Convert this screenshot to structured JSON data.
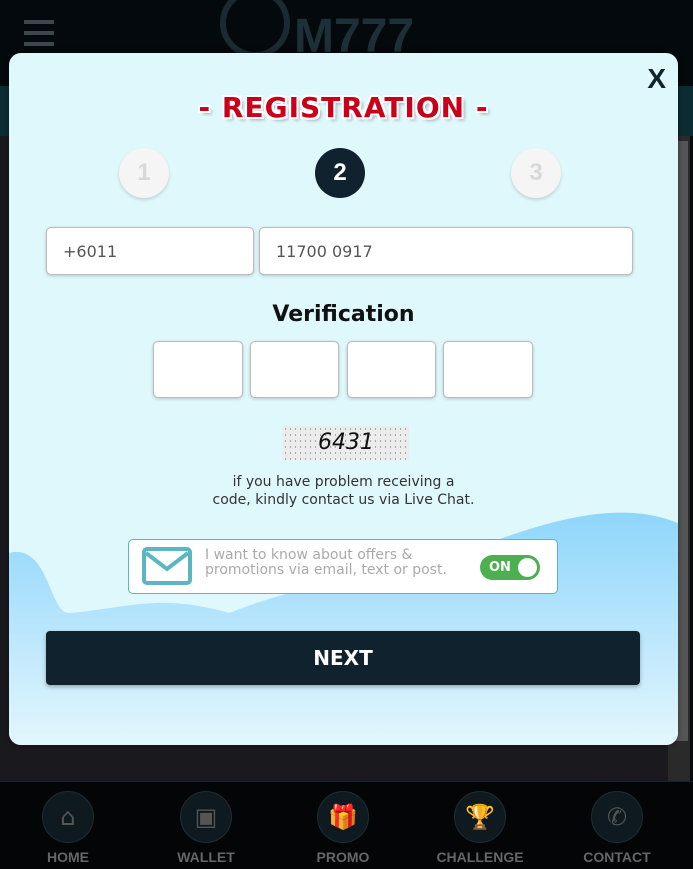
{
  "header": {
    "logo_text": "M777"
  },
  "modal": {
    "close_label": "X",
    "title": "REGISTRATION",
    "title_dash": "-",
    "steps": [
      {
        "label": "1",
        "active": false
      },
      {
        "label": "2",
        "active": true
      },
      {
        "label": "3",
        "active": false
      }
    ],
    "country_code": "+6011",
    "phone_number": "11700 0917",
    "verification_label": "Verification",
    "captcha_code": "6431",
    "help_line1": "if you have problem receiving a",
    "help_line2": "code, kindly contact us via Live Chat.",
    "promo_line1": "I want to know about offers &",
    "promo_line2": "promotions via email, text or post.",
    "promo_toggle": "ON",
    "next_label": "NEXT"
  },
  "nav": {
    "items": [
      {
        "label": "HOME",
        "icon": "home-icon",
        "glyph": "⌂"
      },
      {
        "label": "WALLET",
        "icon": "wallet-icon",
        "glyph": "▣"
      },
      {
        "label": "PROMO",
        "icon": "gift-icon",
        "glyph": "🎁"
      },
      {
        "label": "CHALLENGE",
        "icon": "trophy-icon",
        "glyph": "🏆"
      },
      {
        "label": "CONTACT",
        "icon": "phone-icon",
        "glyph": "✆"
      }
    ]
  },
  "colors": {
    "accent": "#10222e",
    "toggle_on": "#4caf50",
    "title": "#c8001a",
    "modal_bg": "#dff8fc"
  }
}
